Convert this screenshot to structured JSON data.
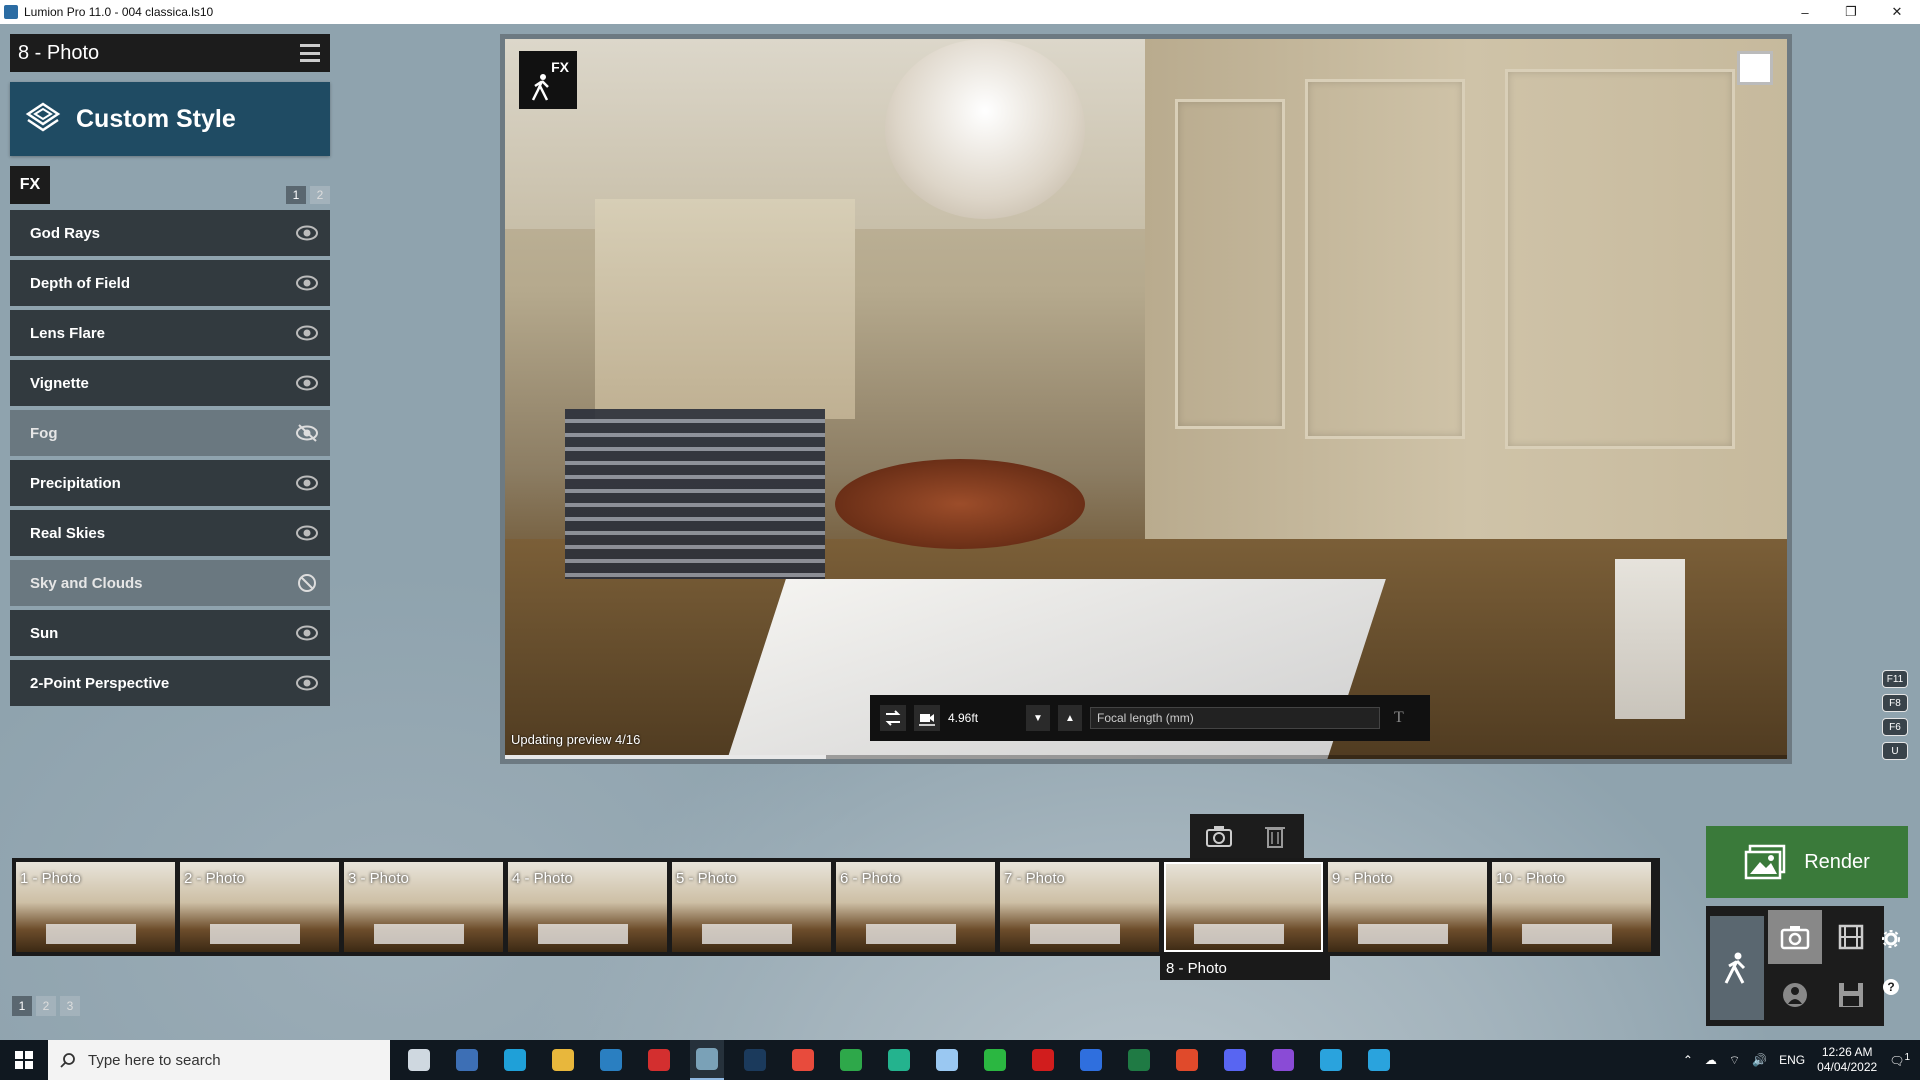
{
  "window": {
    "title": "Lumion Pro 11.0  - 004 classica.ls10",
    "controls": [
      "–",
      "❐",
      "✕"
    ]
  },
  "left_panel": {
    "photo_title": "8 - Photo",
    "custom_style": "Custom Style",
    "fx_tab": "FX",
    "pages": [
      "1",
      "2"
    ],
    "effects": [
      {
        "label": "God Rays",
        "icon": "eye-icon"
      },
      {
        "label": "Depth of Field",
        "icon": "eye-icon"
      },
      {
        "label": "Lens Flare",
        "icon": "eye-icon"
      },
      {
        "label": "Vignette",
        "icon": "eye-icon"
      },
      {
        "label": "Fog",
        "icon": "eye-off-icon"
      },
      {
        "label": "Precipitation",
        "icon": "eye-icon"
      },
      {
        "label": "Real Skies",
        "icon": "eye-icon"
      },
      {
        "label": "Sky and Clouds",
        "icon": "disabled-icon"
      },
      {
        "label": "Sun",
        "icon": "eye-icon"
      },
      {
        "label": "2-Point Perspective",
        "icon": "eye-icon"
      }
    ]
  },
  "viewport": {
    "fx_badge": "FX",
    "preview_status": "Updating preview 4/16",
    "preview_progress": 0.25,
    "camera": {
      "height_value": "4.96ft",
      "focal_placeholder": "Focal length (mm)",
      "t_label": "T"
    }
  },
  "fkeys": [
    "F11",
    "F8",
    "F6",
    "U"
  ],
  "photo_strip": {
    "thumbnails": [
      "1 - Photo",
      "2 - Photo",
      "3 - Photo",
      "4 - Photo",
      "5 - Photo",
      "6 - Photo",
      "7 - Photo",
      "",
      "9 - Photo",
      "10 - Photo"
    ],
    "selected_caption": "8 - Photo",
    "pages": [
      "1",
      "2",
      "3"
    ]
  },
  "render": {
    "label": "Render"
  },
  "taskbar": {
    "search_placeholder": "Type here to search",
    "language": "ENG",
    "time": "12:26 AM",
    "date": "04/04/2022",
    "notifications": "1",
    "apps": [
      {
        "name": "task-view",
        "color": "#cfd8e0"
      },
      {
        "name": "calculator",
        "color": "#3d6fb5"
      },
      {
        "name": "edge",
        "color": "#1fa0d8"
      },
      {
        "name": "file-explorer",
        "color": "#e8b73c"
      },
      {
        "name": "app-s",
        "color": "#2a7fc1"
      },
      {
        "name": "acrobat",
        "color": "#d32f2f"
      },
      {
        "name": "lumion",
        "color": "#7aa1b7"
      },
      {
        "name": "photoshop",
        "color": "#1b3a5c"
      },
      {
        "name": "chrome",
        "color": "#e84b3c"
      },
      {
        "name": "chrome-2",
        "color": "#2ea84a"
      },
      {
        "name": "app-map",
        "color": "#24b38e"
      },
      {
        "name": "app-files",
        "color": "#9ac8f2"
      },
      {
        "name": "whatsapp",
        "color": "#2bb741"
      },
      {
        "name": "opera",
        "color": "#d11d1d"
      },
      {
        "name": "todo",
        "color": "#2f6fde"
      },
      {
        "name": "excel",
        "color": "#1f7a44"
      },
      {
        "name": "grammarly",
        "color": "#e04a2b"
      },
      {
        "name": "discord",
        "color": "#5865f2"
      },
      {
        "name": "podcast",
        "color": "#8a4bd6"
      },
      {
        "name": "telegram",
        "color": "#2aa3dd"
      },
      {
        "name": "telegram-2",
        "color": "#2aa3dd"
      }
    ]
  }
}
